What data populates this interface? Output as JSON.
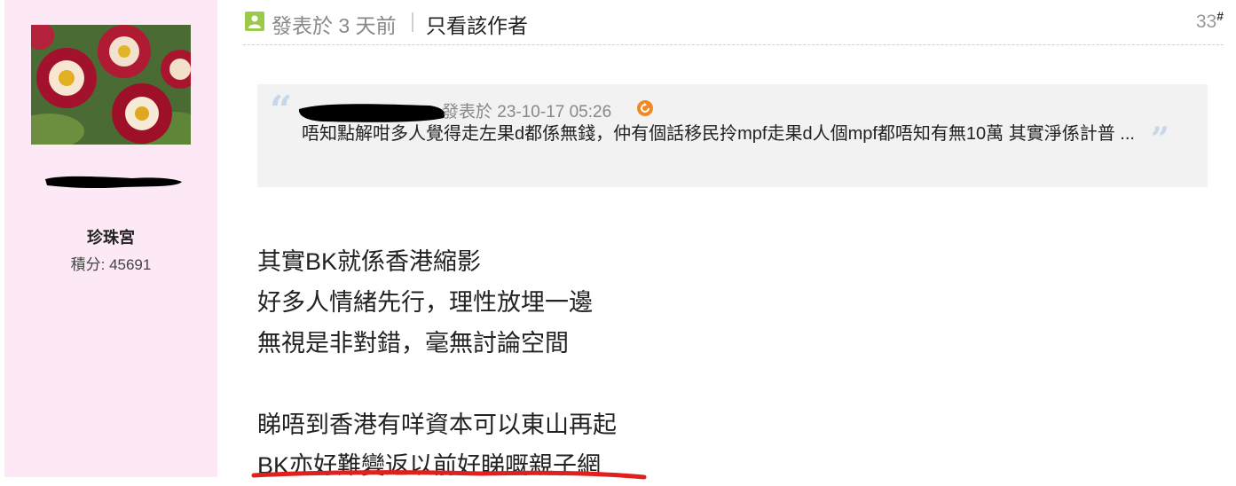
{
  "author": {
    "rank": "珍珠宮",
    "points_text": "積分: 45691"
  },
  "post": {
    "posted_at": "發表於 3 天前",
    "separator": "|",
    "author_only_link": "只看該作者",
    "floor_number": "33",
    "floor_suffix": "#"
  },
  "quote": {
    "posted_at": "發表於 23-10-17 05:26",
    "text": "唔知點解咁多人覺得走左果d都係無錢，仲有個話移民拎mpf走果d人個mpf都唔知有無10萬 其實淨係計普 ..."
  },
  "message": {
    "lines": [
      "其實BK就係香港縮影",
      "好多人情緒先行，理性放埋一邊",
      "無視是非對錯，毫無討論空間",
      "",
      "睇唔到香港有咩資本可以東山再起",
      "BK亦好難變返以前好睇嘅親子網"
    ]
  },
  "colors": {
    "sidebar_bg": "#fde8f6",
    "quote_bg": "#f2f2f2",
    "user_icon": "#9bc94a",
    "goto_icon": "#f08a24",
    "underline": "#e0201c"
  },
  "icons": [
    "avatar-image",
    "user-icon",
    "goto-arrow-icon",
    "quote-open-icon",
    "quote-close-icon"
  ]
}
